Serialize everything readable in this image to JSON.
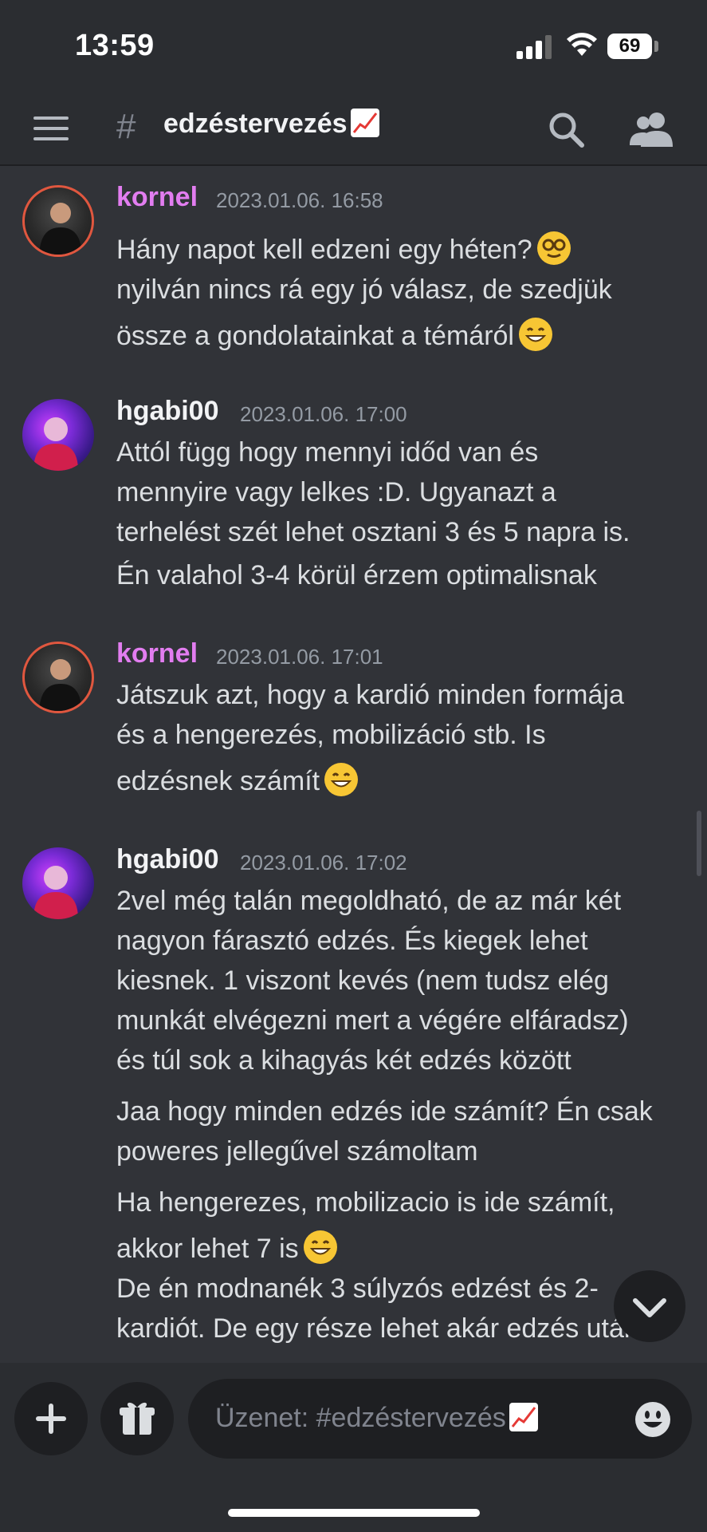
{
  "status_bar": {
    "time": "13:59",
    "battery": "69"
  },
  "header": {
    "hash": "#",
    "channel_name": "edzéstervezés"
  },
  "messages": [
    {
      "author": "kornel",
      "timestamp": "2023.01.06. 16:58",
      "lines": [
        "Hány napot kell edzeni egy héten?",
        "nyilván nincs rá egy jó válasz, de szedjük",
        "össze a gondolatainkat a témáról"
      ]
    },
    {
      "author": "hgabi00",
      "timestamp": "2023.01.06. 17:00",
      "lines": [
        "Attól függ hogy mennyi időd van és",
        "mennyire vagy lelkes :D. Ugyanazt a",
        "terhelést szét lehet osztani 3 és 5 napra is.",
        "Én valahol 3-4 körül érzem optimalisnak"
      ]
    },
    {
      "author": "kornel",
      "timestamp": "2023.01.06. 17:01",
      "lines": [
        "Játszuk azt, hogy a kardió minden formája",
        "és a hengerezés, mobilizáció stb. Is",
        "edzésnek számít"
      ]
    },
    {
      "author": "hgabi00",
      "timestamp": "2023.01.06. 17:02",
      "lines": [
        "2vel még talán megoldható, de az már két",
        "nagyon fárasztó edzés. És kiegek lehet",
        "kiesnek. 1 viszont kevés (nem tudsz elég",
        "munkát elvégezni mert a végére elfáradsz)",
        "és túl sok a kihagyás két edzés között",
        "Jaa hogy minden edzés ide számít? Én csak",
        "poweres jellegűvel számoltam",
        "Ha hengerezes, mobilizacio is ide számít,",
        "akkor lehet 7 is",
        "De én modnanék 3 súlyzós edzést és 2-",
        "kardiót. De egy része lehet akár edzés után"
      ]
    }
  ],
  "composer": {
    "placeholder": "Üzenet: #edzéstervezés"
  },
  "icons": {
    "menu": "hamburger-menu-icon",
    "search": "search-icon",
    "members": "members-icon",
    "add": "plus-icon",
    "gift": "gift-icon",
    "emoji": "smiley-icon",
    "jump": "chevron-down-icon"
  },
  "colors": {
    "background": "#313338",
    "header": "#2b2d31",
    "kornel_name": "#e27df0",
    "avatar_ring": "#e0573f",
    "timestamp": "#949ba4"
  }
}
